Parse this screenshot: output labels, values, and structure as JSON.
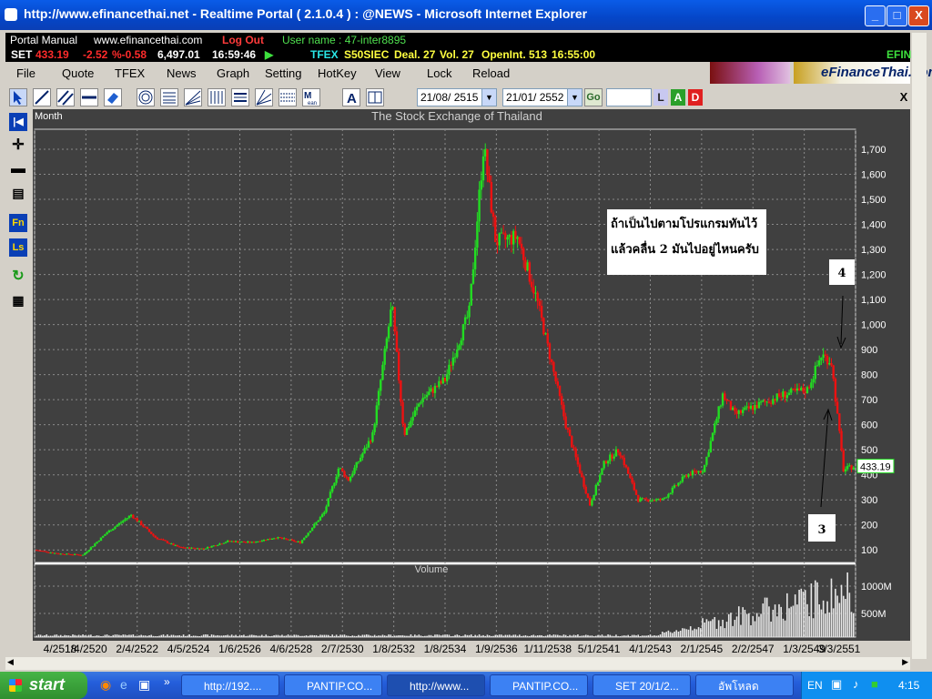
{
  "window": {
    "title": "http://www.efinancethai.net - Realtime Portal ( 2.1.0.4 ) : @NEWS - Microsoft Internet Explorer",
    "controls": {
      "minimize": "_",
      "maximize": "□",
      "close": "X"
    }
  },
  "portal": {
    "manual": "Portal Manual",
    "site": "www.efinancethai.com",
    "logout": "Log Out",
    "user": "User name : 47-inter8895"
  },
  "ticker": {
    "set_label": "SET",
    "set_value": "433.19",
    "change": "-2.52",
    "pct_change": "%-0.58",
    "turnover": "6,497.01",
    "time": "16:59:46",
    "tfex_label": "TFEX",
    "series": "S50SIEC",
    "deal": "Deal. 27",
    "vol": "Vol. 27",
    "openint": "OpenInt. 513",
    "tfex_time": "16:55:00",
    "efin": "EFIN"
  },
  "menu": [
    "File",
    "Quote",
    "TFEX",
    "News",
    "Graph",
    "Setting",
    "HotKey",
    "View",
    "Lock",
    "Reload"
  ],
  "banner": {
    "brand": "eFinanceThai.com"
  },
  "toolbar": {
    "date_from": "21/08/ 2515",
    "date_to": "21/01/ 2552",
    "go": "Go",
    "search_value": "",
    "btn_l": "L",
    "btn_a": "A",
    "btn_d": "D",
    "close": "X"
  },
  "left_tools": {
    "fn": "Fn",
    "ls": "Ls"
  },
  "colors": {
    "up": "#22dd22",
    "down": "#ee1111",
    "background": "#404040",
    "grid": "#8a8a8a"
  },
  "chart_data": {
    "type": "candlestick",
    "title": "The Stock Exchange of Thailand",
    "period": "Month",
    "volume_label": "Volume",
    "current_value": "433.19",
    "y_ticks": [
      "1,700",
      "1,600",
      "1,500",
      "1,400",
      "1,300",
      "1,200",
      "1,100",
      "1,000",
      "900",
      "800",
      "700",
      "600",
      "500",
      "400",
      "300",
      "200",
      "100"
    ],
    "y_range": [
      50,
      1780
    ],
    "volume_ticks": [
      "1000M",
      "500M"
    ],
    "x_ticks": [
      "4/2518",
      "1/4/2520",
      "2/4/2522",
      "4/5/2524",
      "1/6/2526",
      "4/6/2528",
      "2/7/2530",
      "1/8/2532",
      "1/8/2534",
      "1/9/2536",
      "1/11/2538",
      "5/1/2541",
      "4/1/2543",
      "2/1/2545",
      "2/2/2547",
      "1/3/2549",
      "3/3/2551"
    ],
    "x_range": [
      2518,
      2552
    ],
    "series_path": [
      [
        2518.0,
        100
      ],
      [
        2519.0,
        85
      ],
      [
        2520.0,
        80
      ],
      [
        2521.0,
        170
      ],
      [
        2522.0,
        240
      ],
      [
        2523.0,
        150
      ],
      [
        2524.0,
        110
      ],
      [
        2525.0,
        105
      ],
      [
        2526.0,
        135
      ],
      [
        2527.0,
        130
      ],
      [
        2528.0,
        150
      ],
      [
        2529.0,
        130
      ],
      [
        2530.0,
        250
      ],
      [
        2530.6,
        430
      ],
      [
        2531.0,
        380
      ],
      [
        2532.0,
        560
      ],
      [
        2532.8,
        1080
      ],
      [
        2533.3,
        560
      ],
      [
        2534.0,
        700
      ],
      [
        2535.0,
        780
      ],
      [
        2536.0,
        1050
      ],
      [
        2536.6,
        1720
      ],
      [
        2537.1,
        1330
      ],
      [
        2538.0,
        1350
      ],
      [
        2538.8,
        1100
      ],
      [
        2540.0,
        600
      ],
      [
        2541.0,
        280
      ],
      [
        2541.6,
        450
      ],
      [
        2542.2,
        500
      ],
      [
        2543.0,
        300
      ],
      [
        2544.0,
        300
      ],
      [
        2545.0,
        400
      ],
      [
        2545.7,
        420
      ],
      [
        2546.5,
        720
      ],
      [
        2547.0,
        640
      ],
      [
        2548.0,
        680
      ],
      [
        2549.0,
        720
      ],
      [
        2550.0,
        740
      ],
      [
        2550.6,
        880
      ],
      [
        2551.0,
        850
      ],
      [
        2551.5,
        420
      ],
      [
        2551.9,
        433
      ]
    ],
    "annotations": [
      {
        "text": "ถ้าเป็นไปตามโปรแกรมทันไว้\nแล้วคลื่น 2 มันไปอยู่ไหนครับ"
      },
      {
        "text": "4"
      },
      {
        "text": "3"
      }
    ]
  },
  "taskbar": {
    "start": "start",
    "tasks": [
      "http://192....",
      "PANTIP.CO...",
      "http://www...",
      "PANTIP.CO...",
      "SET 20/1/2...",
      "อัพโหลด"
    ],
    "lang": "EN",
    "clock": "4:15"
  }
}
